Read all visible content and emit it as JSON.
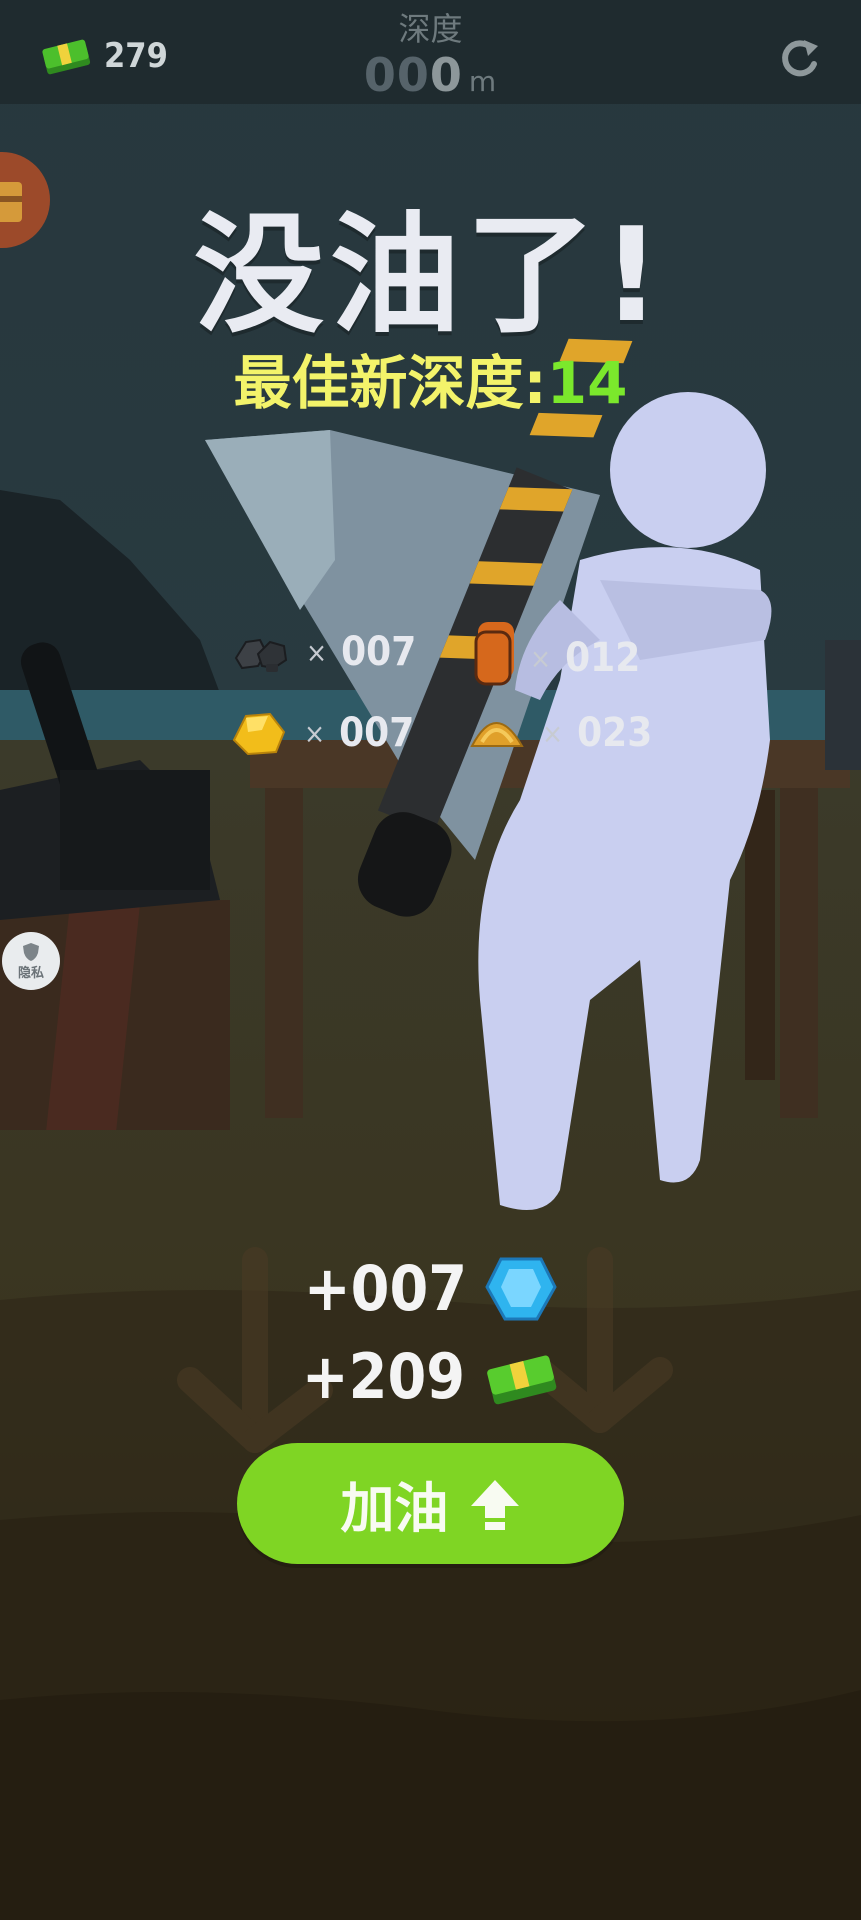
{
  "top_bar": {
    "cash": "279",
    "depth_label": "深度",
    "depth_leading": "00",
    "depth_digit": "0",
    "depth_unit": "m"
  },
  "result": {
    "title": "没油了!",
    "best_label": "最佳新深度:",
    "best_value": "14"
  },
  "collected": {
    "coal": "007",
    "orange_ore": "012",
    "gold": "007",
    "amber": "023"
  },
  "rewards": {
    "gems": "+007",
    "cash": "+209"
  },
  "privacy_badge": "隐私",
  "refuel_button": "加油"
}
